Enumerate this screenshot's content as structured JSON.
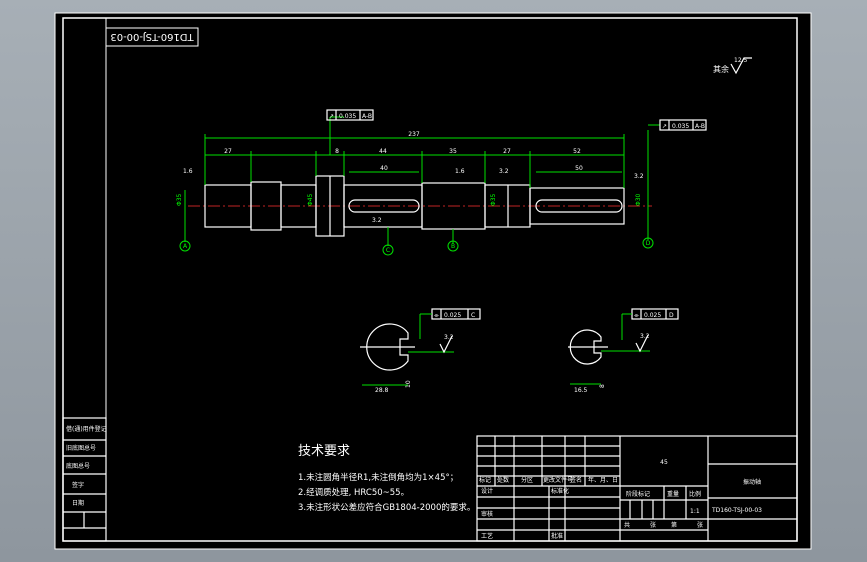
{
  "drawing": {
    "stamp": "TD160-TSJ-00-03",
    "roughness_note": "其余",
    "roughness_note_value": "12.5",
    "dims": {
      "overall": "237",
      "d1": "27",
      "d2": "8",
      "d3": "44",
      "d4": "35",
      "d5": "27",
      "d6": "52",
      "key1": "40",
      "key2": "50",
      "r1": "1.6",
      "r2": "3.2",
      "r3": "1.6",
      "r4": "3.2",
      "r5": "3.2",
      "dia1": "Φ35",
      "dia2": "Φ45",
      "dia3": "Φ35",
      "dia4": "Φ30"
    },
    "tol_frames": {
      "top_left": {
        "symbol": "↗",
        "value": "0.035",
        "datum": "A-B"
      },
      "top_right": {
        "symbol": "↗",
        "value": "0.035",
        "datum": "A-B"
      },
      "sec1": {
        "symbol": "⌯",
        "value": "0.025",
        "datum": "C"
      },
      "sec2": {
        "symbol": "⌯",
        "value": "0.025",
        "datum": "D"
      }
    },
    "datums": [
      "A",
      "C",
      "B",
      "D"
    ],
    "section_dims": {
      "s1_bottom": "28.8",
      "s1_right": "10",
      "s1_rough": "3.2",
      "s2_bottom": "16.5",
      "s2_right": "8",
      "s2_rough": "3.2"
    }
  },
  "requirements": {
    "heading": "技术要求",
    "items": [
      "1.未注圆角半径R1,未注倒角均为1×45°；",
      "2.经调质处理, HRC50~55。",
      "3.未注形状公差应符合GB1804-2000的要求。"
    ]
  },
  "title_block": {
    "material": "45",
    "part_name": "振动轴",
    "drawing_no": "TD160-TSJ-00-03",
    "scale": "1:1",
    "row_labels": [
      "标记",
      "处数",
      "分区",
      "更改文件号",
      "签名",
      "年、月、日"
    ],
    "left_labels": [
      "设计",
      "审核",
      "工艺"
    ],
    "mid_labels": [
      "标准化",
      "批准"
    ],
    "stage_labels": [
      "阶段标记",
      "重量",
      "比例"
    ],
    "sheet_labels": [
      "共",
      "张",
      "第",
      "张"
    ]
  },
  "left_panel": {
    "labels": [
      "借(通)用件登记",
      "旧底图总号",
      "底图总号",
      "签字",
      "日期"
    ]
  }
}
